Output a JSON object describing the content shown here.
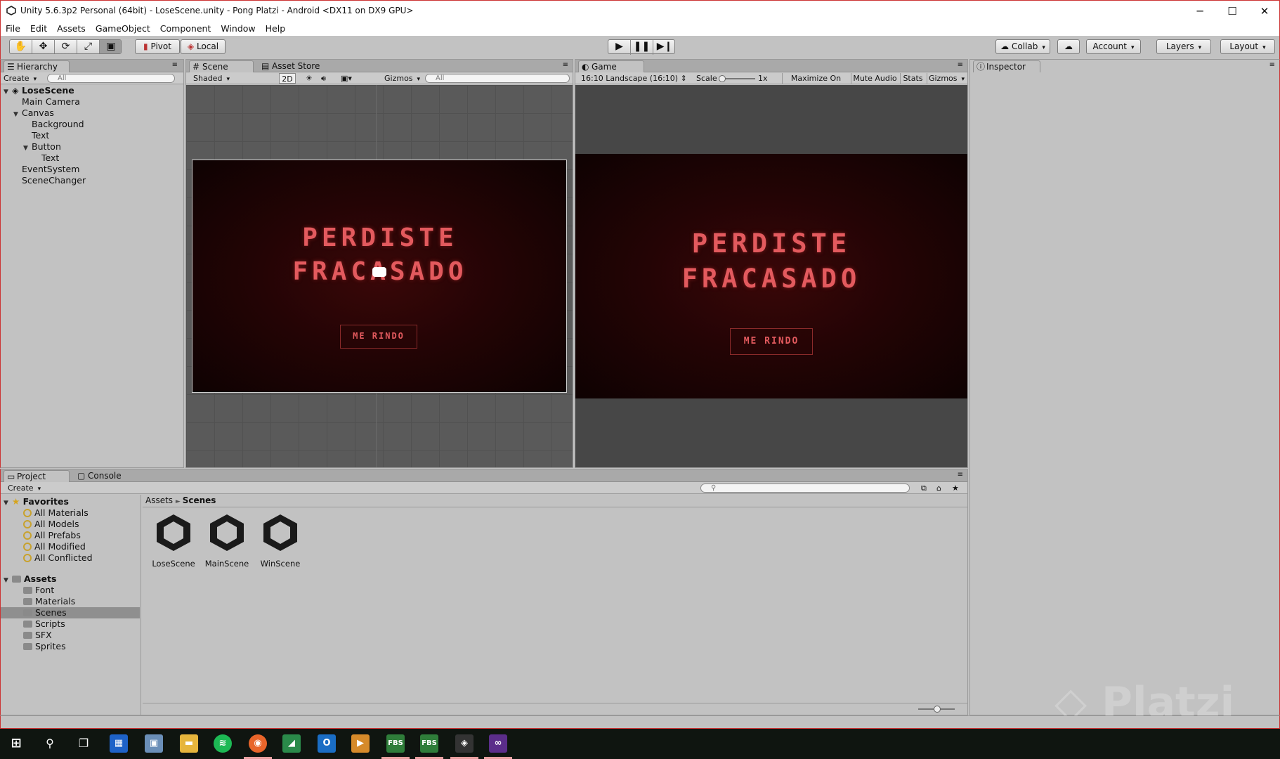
{
  "window": {
    "title": "Unity 5.6.3p2 Personal (64bit) - LoseScene.unity - Pong Platzi - Android <DX11 on DX9 GPU>",
    "controls": [
      "─",
      "☐",
      "✕"
    ]
  },
  "menu": [
    "File",
    "Edit",
    "Assets",
    "GameObject",
    "Component",
    "Window",
    "Help"
  ],
  "toolbar": {
    "transform_tools": [
      "hand-icon",
      "move-icon",
      "rotate-icon",
      "scale-icon",
      "rect-icon"
    ],
    "pivot": "Pivot",
    "local": "Local",
    "collab": "Collab",
    "account": "Account",
    "layers": "Layers",
    "layout": "Layout"
  },
  "hierarchy": {
    "tab": "Hierarchy",
    "create": "Create",
    "search_placeholder": "All",
    "scene": "LoseScene",
    "items": [
      {
        "label": "Main Camera",
        "depth": 1,
        "expand": ""
      },
      {
        "label": "Canvas",
        "depth": 1,
        "expand": "▼"
      },
      {
        "label": "Background",
        "depth": 2,
        "expand": ""
      },
      {
        "label": "Text",
        "depth": 2,
        "expand": ""
      },
      {
        "label": "Button",
        "depth": 2,
        "expand": "▼"
      },
      {
        "label": "Text",
        "depth": 3,
        "expand": ""
      },
      {
        "label": "EventSystem",
        "depth": 1,
        "expand": ""
      },
      {
        "label": "SceneChanger",
        "depth": 1,
        "expand": ""
      }
    ]
  },
  "scene": {
    "tab": "Scene",
    "tab2": "Asset Store",
    "shading": "Shaded",
    "mode2d": "2D",
    "gizmos": "Gizmos",
    "search_placeholder": "All",
    "line1": "PERDISTE",
    "line2": "FRACASADO",
    "button": "ME RINDO"
  },
  "game": {
    "tab": "Game",
    "aspect": "16:10 Landscape (16:10)",
    "scale_label": "Scale",
    "scale_value": "1x",
    "maximize": "Maximize On Play",
    "mute": "Mute Audio",
    "stats": "Stats",
    "gizmos": "Gizmos",
    "line1": "PERDISTE",
    "line2": "FRACASADO",
    "button": "ME RINDO"
  },
  "inspector": {
    "tab": "Inspector"
  },
  "project": {
    "tab": "Project",
    "tab2": "Console",
    "create": "Create",
    "favorites_label": "Favorites",
    "favorites": [
      "All Materials",
      "All Models",
      "All Prefabs",
      "All Modified",
      "All Conflicted"
    ],
    "assets_label": "Assets",
    "folders": [
      "Font",
      "Materials",
      "Scenes",
      "Scripts",
      "SFX",
      "Sprites"
    ],
    "selected_folder": "Scenes",
    "breadcrumb": [
      "Assets",
      "Scenes"
    ],
    "files": [
      "LoseScene",
      "MainScene",
      "WinScene"
    ]
  },
  "watermark": "Platzi",
  "taskbar": {
    "apps": [
      "windows-start-icon",
      "search-icon",
      "task-view-icon",
      "app-grid-icon",
      "photos-icon",
      "file-explorer-icon",
      "spotify-icon",
      "firefox-icon",
      "chart-app-icon",
      "outlook-icon",
      "media-player-icon",
      "fbs-icon",
      "fbs-icon-2",
      "unity-icon",
      "visual-studio-icon"
    ],
    "fbs_label": "FBS"
  },
  "colors": {
    "accent_red": "#e35a5e",
    "panel": "#c2c2c2",
    "selection": "#8f8f8f"
  }
}
